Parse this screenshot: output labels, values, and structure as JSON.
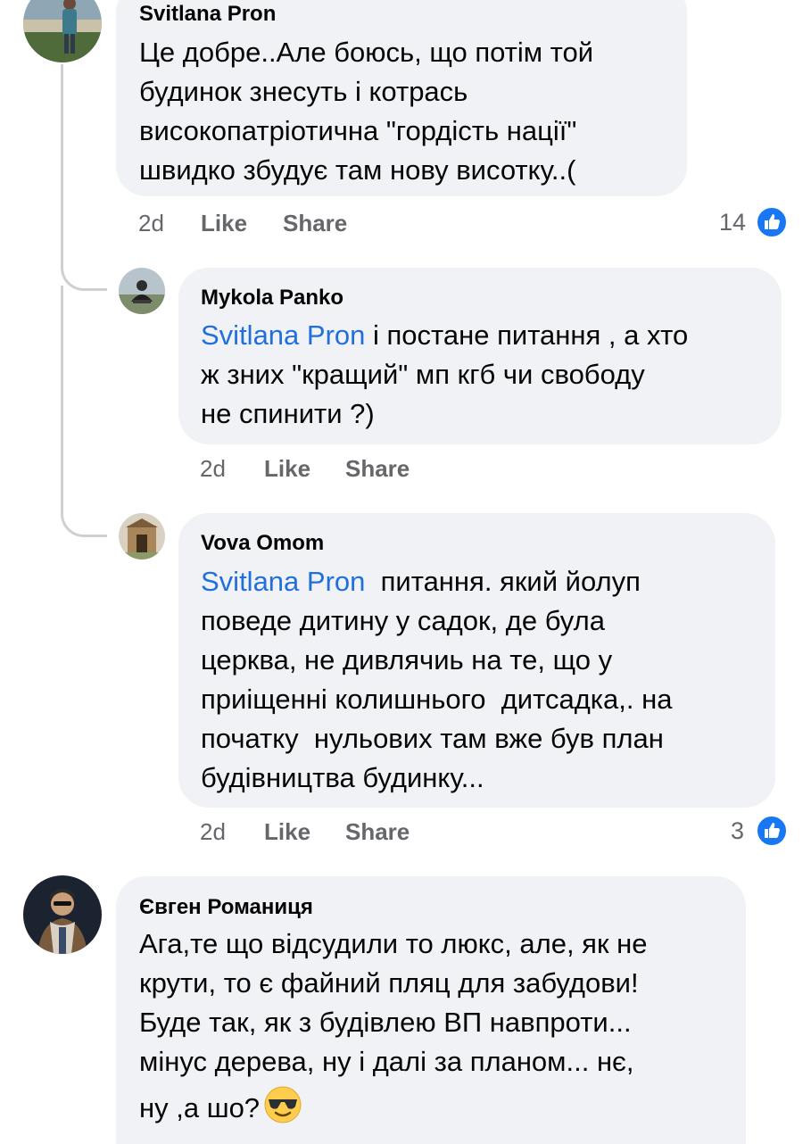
{
  "comments": [
    {
      "author": "Svitlana Pron",
      "lines": [
        "Це добре..Але боюсь, що потім той",
        "будинок знесуть і котрась",
        "високопатріотична \"гордість нації\"",
        "швидко збудує там нову висотку..("
      ],
      "time": "2d",
      "like_label": "Like",
      "share_label": "Share",
      "reaction_count": "14"
    },
    {
      "author": "Mykola Panko",
      "mention": "Svitlana Pron",
      "lines": [
        " і постане питання , а хто",
        "ж зних \"кращий\" мп кгб чи свободу",
        "не спинити ?)"
      ],
      "time": "2d",
      "like_label": "Like",
      "share_label": "Share"
    },
    {
      "author": "Vova Omom",
      "mention": "Svitlana Pron",
      "lines": [
        "  питання. який йолуп",
        "поведе дитину у садок, де була",
        "церква, не дивлячиь на те, що у",
        "приіщенні колишнього  дитсадка,. на",
        "початку  нульових там вже був план",
        "будівництва будинку..."
      ],
      "time": "2d",
      "like_label": "Like",
      "share_label": "Share",
      "reaction_count": "3"
    },
    {
      "author": "Євген Романиця",
      "lines": [
        "Ага,те що відсудили то люкс, але, як не",
        "крути, то є файний пляц для забудови!",
        "Буде так, як з будівлею ВП навпроти...",
        "мінус дерева, ну і далі за планом... нє,",
        "ну ,а шо?"
      ],
      "emoji": "sunglasses-emoji"
    }
  ],
  "colors": {
    "bubble": "#f0f2f5",
    "mention": "#216fdb",
    "meta": "#65676b",
    "like_blue": "#1877f2",
    "thread": "#ced0d4"
  }
}
